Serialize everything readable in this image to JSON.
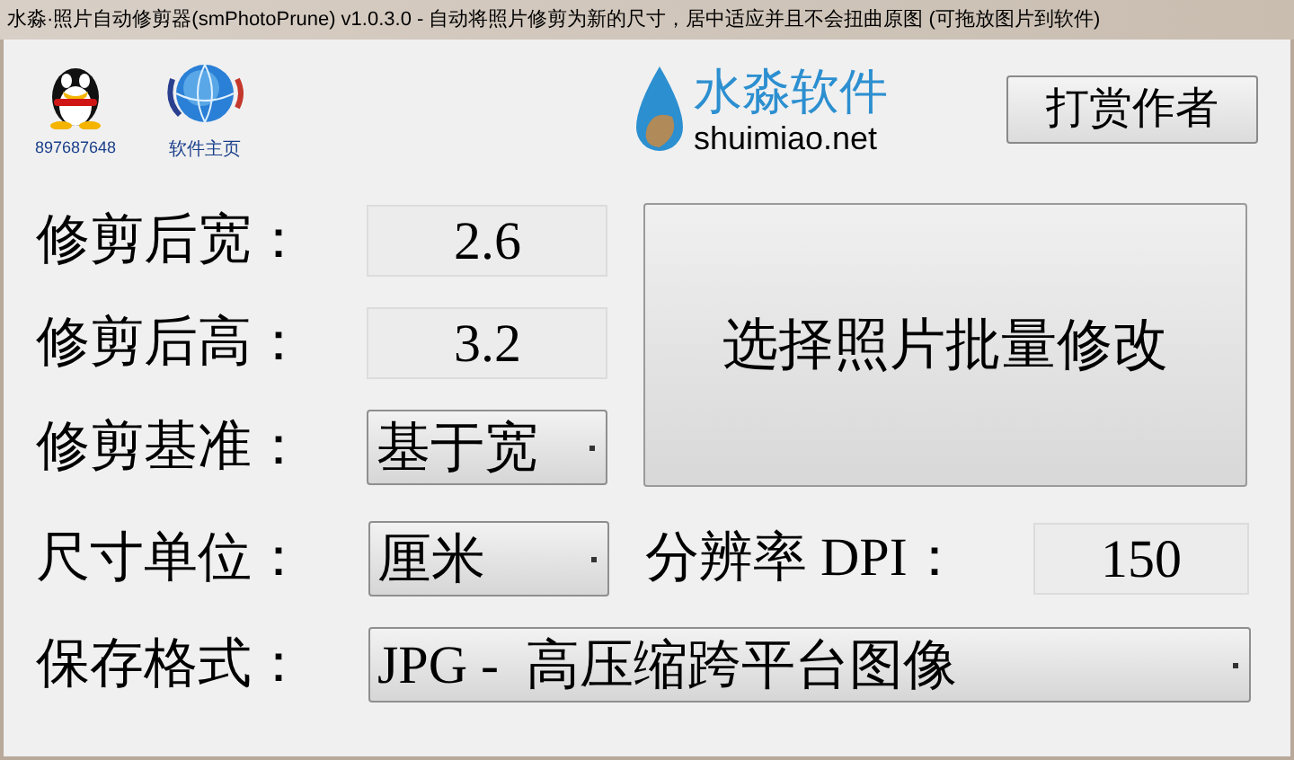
{
  "window": {
    "title": "水淼·照片自动修剪器(smPhotoPrune) v1.0.3.0 - 自动将照片修剪为新的尺寸，居中适应并且不会扭曲原图  (可拖放图片到软件)"
  },
  "header": {
    "qq_label": "897687648",
    "homepage_label": "软件主页",
    "logo_name": "水淼软件",
    "logo_url": "shuimiao.net",
    "donate_button": "打赏作者"
  },
  "fields": [
    {
      "label": "修剪后宽：",
      "kind": "input",
      "value": "2.6"
    },
    {
      "label": "修剪后高：",
      "kind": "input",
      "value": "3.2"
    },
    {
      "label": "修剪基准：",
      "kind": "select",
      "value": "基于宽"
    }
  ],
  "batch_button": "选择照片批量修改",
  "unit": {
    "label": "尺寸单位：",
    "kind": "select",
    "value": "厘米"
  },
  "dpi": {
    "label": "分辨率 DPI：",
    "kind": "input",
    "value": "150"
  },
  "format": {
    "label": "保存格式：",
    "kind": "select",
    "value": "JPG -  高压缩跨平台图像"
  }
}
